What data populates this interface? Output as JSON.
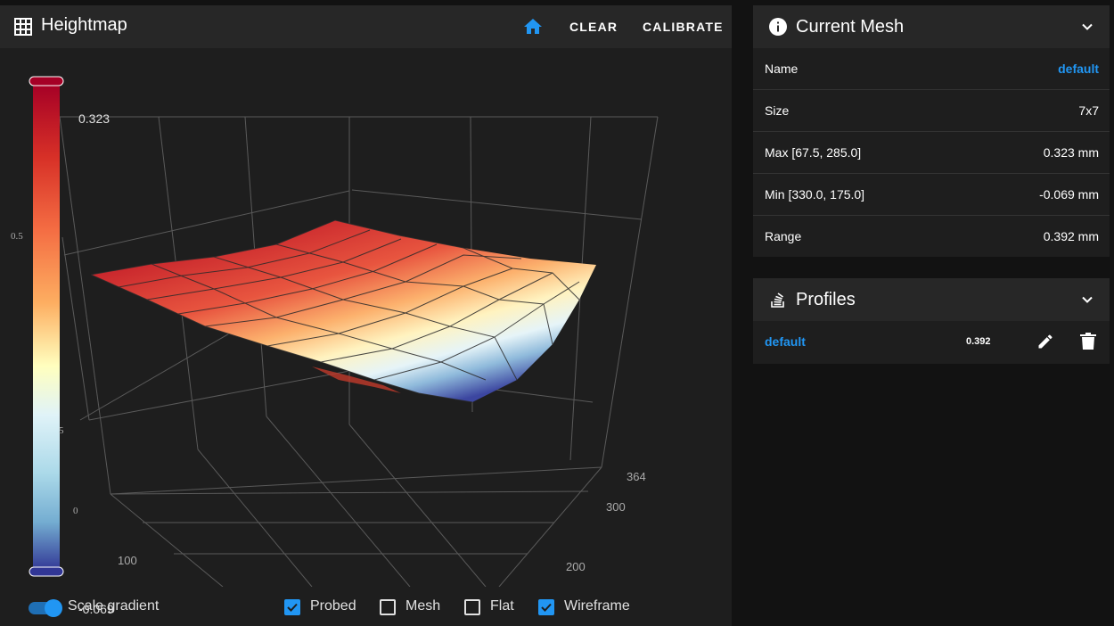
{
  "heightmap": {
    "title": "Heightmap",
    "home_icon": "home-icon",
    "clear_label": "CLEAR",
    "calibrate_label": "CALIBRATE",
    "colorbar": {
      "max_label": "0.323",
      "min_label": "-0.069"
    },
    "axis_ticks": {
      "z_mid": "0.5",
      "z_low": "5",
      "z_zero": "0",
      "x_100": "100",
      "y_200": "200",
      "y_300": "300",
      "y_364": "364"
    },
    "footer": {
      "scale_gradient_label": "Scale gradient",
      "scale_gradient_on": true,
      "probed_label": "Probed",
      "probed_checked": true,
      "mesh_label": "Mesh",
      "mesh_checked": false,
      "flat_label": "Flat",
      "flat_checked": false,
      "wireframe_label": "Wireframe",
      "wireframe_checked": true
    },
    "colors": {
      "accent": "#2196f3",
      "high": "#a50026",
      "low": "#313695",
      "mid": "#ffffbf"
    }
  },
  "current_mesh": {
    "title": "Current Mesh",
    "rows": [
      {
        "label": "Name",
        "value": "default"
      },
      {
        "label": "Size",
        "value": "7x7"
      },
      {
        "label": "Max [67.5, 285.0]",
        "value": "0.323 mm"
      },
      {
        "label": "Min [330.0, 175.0]",
        "value": "-0.069 mm"
      },
      {
        "label": "Range",
        "value": "0.392 mm"
      }
    ]
  },
  "profiles": {
    "title": "Profiles",
    "items": [
      {
        "name": "default",
        "range": "0.392"
      }
    ]
  }
}
